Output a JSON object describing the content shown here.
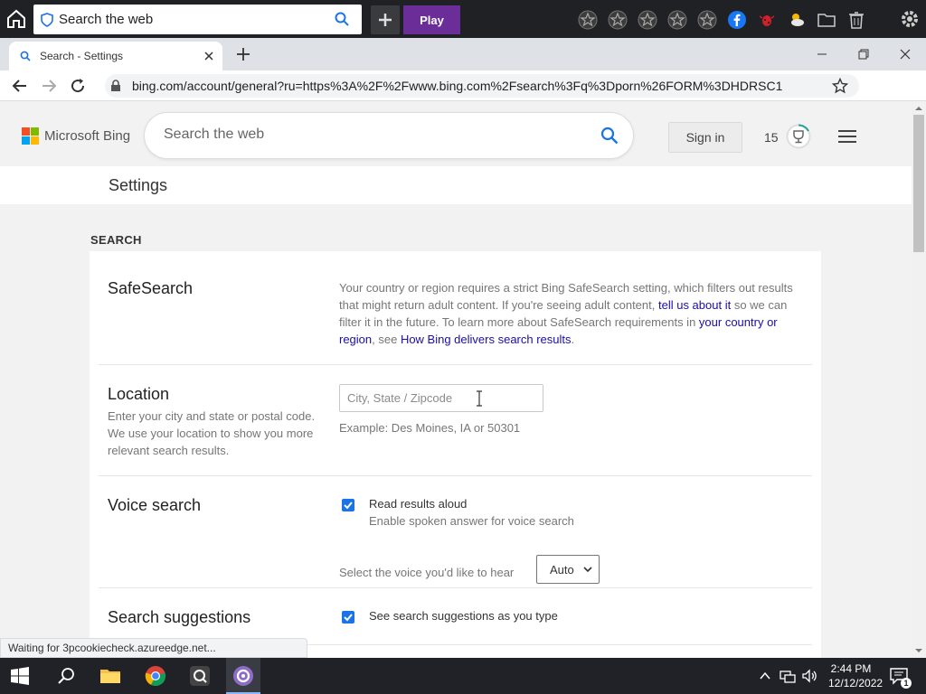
{
  "toolbar": {
    "search_text": "Search the web",
    "play_label": "Play",
    "icons": [
      "home-icon",
      "shield-icon",
      "search-icon",
      "plus-icon",
      "star-icon",
      "star-icon",
      "star-icon",
      "star-icon",
      "star-icon",
      "facebook-icon",
      "bug-icon",
      "weather-icon",
      "folder-icon",
      "trash-icon",
      "gear-icon"
    ]
  },
  "tab": {
    "title": "Search - Settings"
  },
  "address": {
    "url": "bing.com/account/general?ru=https%3A%2F%2Fwww.bing.com%2Fsearch%3Fq%3Dporn%26FORM%3DHDRSC1"
  },
  "bing": {
    "logo_text": "Microsoft Bing",
    "search_placeholder": "Search the web",
    "signin_label": "Sign in",
    "rewards_count": "15",
    "page_title": "Settings",
    "section_label": "SEARCH"
  },
  "safesearch": {
    "heading": "SafeSearch",
    "desc_1": "Your country or region requires a strict Bing SafeSearch setting, which filters out results that might return adult content. If you're seeing adult content, ",
    "link_1": "tell us about it",
    "desc_2": " so we can filter it in the future. To learn more about SafeSearch requirements in ",
    "link_2": "your country or region",
    "desc_3": ", see ",
    "link_3": "How Bing delivers search results",
    "desc_4": "."
  },
  "location": {
    "heading": "Location",
    "sub": "Enter your city and state or postal code. We use your location to show you more relevant search results.",
    "placeholder": "City, State / Zipcode",
    "example": "Example: Des Moines, IA or 50301"
  },
  "voice": {
    "heading": "Voice search",
    "checkbox_label": "Read results aloud",
    "checkbox_sub": "Enable spoken answer for voice search",
    "checked": true,
    "select_label": "Select the voice you'd like to hear",
    "select_value": "Auto"
  },
  "suggestions": {
    "heading": "Search suggestions",
    "checkbox_label": "See search suggestions as you type",
    "checked": true
  },
  "status_bar": {
    "text": "Waiting for 3pcookiecheck.azureedge.net..."
  },
  "taskbar": {
    "time": "2:44 PM",
    "date": "12/12/2022",
    "notification_count": "1"
  },
  "colors": {
    "link": "#1a0dab",
    "checkbox": "#1a73e8",
    "play": "#6b2e99"
  }
}
